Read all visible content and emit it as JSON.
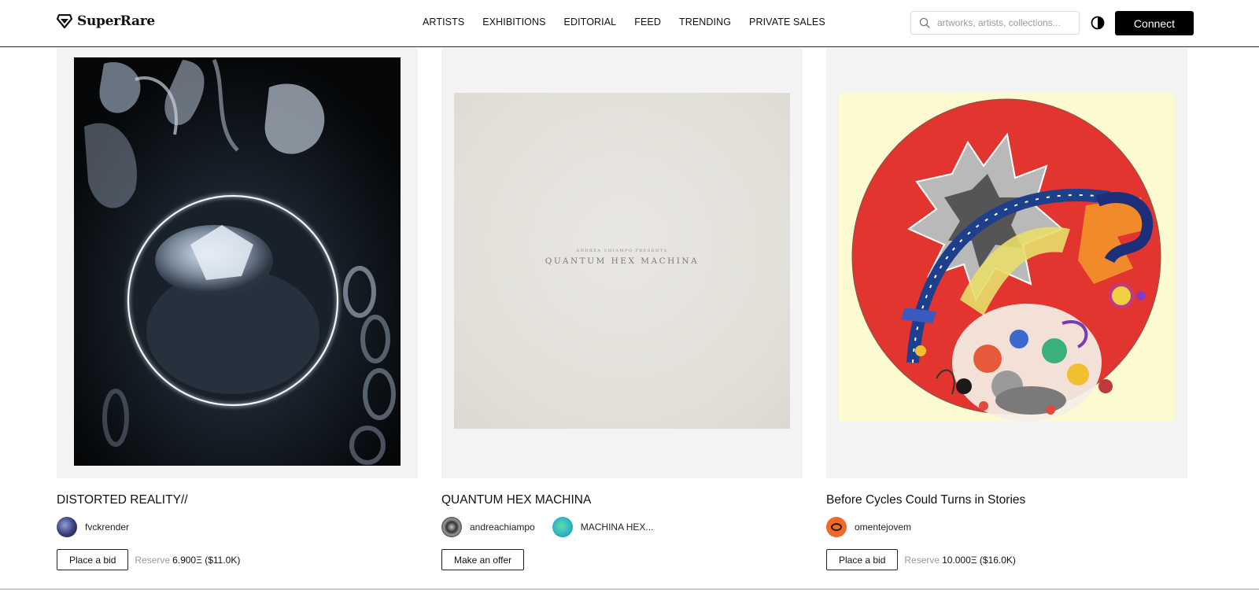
{
  "header": {
    "logo_text": "SuperRare",
    "nav": [
      "ARTISTS",
      "EXHIBITIONS",
      "EDITORIAL",
      "FEED",
      "TRENDING",
      "PRIVATE SALES"
    ],
    "search_placeholder": "artworks, artists, collections...",
    "connect_label": "Connect"
  },
  "cards": [
    {
      "title": "DISTORTED REALITY//",
      "owners": [
        {
          "name": "fvckrender"
        }
      ],
      "action": "Place a bid",
      "reserve_label": "Reserve",
      "reserve_value": "6.900Ξ ($11.0K)"
    },
    {
      "title": "QUANTUM HEX MACHINA",
      "art_caption_small": "ANDREA CHIAMPO PRESENTS",
      "art_caption": "QUANTUM HEX MACHINA",
      "owners": [
        {
          "name": "andreachiampo"
        },
        {
          "name": "MACHINA HEX..."
        }
      ],
      "action": "Make an offer"
    },
    {
      "title": "Before Cycles Could Turns in Stories",
      "owners": [
        {
          "name": "omentejovem"
        }
      ],
      "action": "Place a bid",
      "reserve_label": "Reserve",
      "reserve_value": "10.000Ξ ($16.0K)"
    }
  ],
  "colors": {
    "accent": "#000000",
    "card_bg": "#f3f3f3",
    "art2_bg": "#e4e1dc",
    "art3_bg": "#fdfbd2",
    "art3_red": "#e2352f"
  }
}
